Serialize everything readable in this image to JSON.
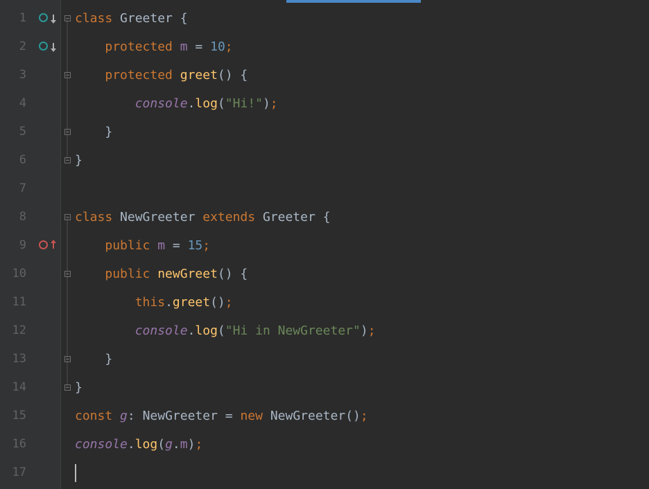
{
  "editor": {
    "lineCount": 17,
    "gutterIcons": {
      "1": "overridden-down",
      "2": "overridden-down",
      "9": "overrides-up"
    },
    "foldMarkers": {
      "1": "open-down",
      "3": "open-down",
      "5": "close-up",
      "6": "close-up",
      "8": "open-down",
      "10": "open-down",
      "13": "close-up",
      "14": "close-up"
    },
    "lines": [
      [
        {
          "t": "class ",
          "c": "keyword"
        },
        {
          "t": "Greeter ",
          "c": "class"
        },
        {
          "t": "{",
          "c": "default"
        }
      ],
      [
        {
          "t": "    ",
          "c": "default"
        },
        {
          "t": "protected ",
          "c": "keyword"
        },
        {
          "t": "m ",
          "c": "prop"
        },
        {
          "t": "= ",
          "c": "default"
        },
        {
          "t": "10",
          "c": "num"
        },
        {
          "t": ";",
          "c": "semi"
        }
      ],
      [
        {
          "t": "    ",
          "c": "default"
        },
        {
          "t": "protected ",
          "c": "keyword"
        },
        {
          "t": "greet",
          "c": "method"
        },
        {
          "t": "() {",
          "c": "default"
        }
      ],
      [
        {
          "t": "        ",
          "c": "default"
        },
        {
          "t": "console",
          "c": "ident-italic"
        },
        {
          "t": ".",
          "c": "default"
        },
        {
          "t": "log",
          "c": "method"
        },
        {
          "t": "(",
          "c": "default"
        },
        {
          "t": "\"Hi!\"",
          "c": "string"
        },
        {
          "t": ")",
          "c": "default"
        },
        {
          "t": ";",
          "c": "semi"
        }
      ],
      [
        {
          "t": "    }",
          "c": "default"
        }
      ],
      [
        {
          "t": "}",
          "c": "default"
        }
      ],
      [
        {
          "t": "",
          "c": "default"
        }
      ],
      [
        {
          "t": "class ",
          "c": "keyword"
        },
        {
          "t": "NewGreeter ",
          "c": "class"
        },
        {
          "t": "extends ",
          "c": "keyword"
        },
        {
          "t": "Greeter ",
          "c": "class"
        },
        {
          "t": "{",
          "c": "default"
        }
      ],
      [
        {
          "t": "    ",
          "c": "default"
        },
        {
          "t": "public ",
          "c": "keyword"
        },
        {
          "t": "m ",
          "c": "prop"
        },
        {
          "t": "= ",
          "c": "default"
        },
        {
          "t": "15",
          "c": "num"
        },
        {
          "t": ";",
          "c": "semi"
        }
      ],
      [
        {
          "t": "    ",
          "c": "default"
        },
        {
          "t": "public ",
          "c": "keyword"
        },
        {
          "t": "newGreet",
          "c": "method"
        },
        {
          "t": "() {",
          "c": "default"
        }
      ],
      [
        {
          "t": "        ",
          "c": "default"
        },
        {
          "t": "this",
          "c": "keyword"
        },
        {
          "t": ".",
          "c": "default"
        },
        {
          "t": "greet",
          "c": "method"
        },
        {
          "t": "()",
          "c": "default"
        },
        {
          "t": ";",
          "c": "semi"
        }
      ],
      [
        {
          "t": "        ",
          "c": "default"
        },
        {
          "t": "console",
          "c": "ident-italic"
        },
        {
          "t": ".",
          "c": "default"
        },
        {
          "t": "log",
          "c": "method"
        },
        {
          "t": "(",
          "c": "default"
        },
        {
          "t": "\"Hi in NewGreeter\"",
          "c": "string"
        },
        {
          "t": ")",
          "c": "default"
        },
        {
          "t": ";",
          "c": "semi"
        }
      ],
      [
        {
          "t": "    }",
          "c": "default"
        }
      ],
      [
        {
          "t": "}",
          "c": "default"
        }
      ],
      [
        {
          "t": "const ",
          "c": "keyword"
        },
        {
          "t": "g",
          "c": "ident-italic"
        },
        {
          "t": ": ",
          "c": "default"
        },
        {
          "t": "NewGreeter ",
          "c": "type"
        },
        {
          "t": "= ",
          "c": "default"
        },
        {
          "t": "new ",
          "c": "keyword"
        },
        {
          "t": "NewGreeter()",
          "c": "default"
        },
        {
          "t": ";",
          "c": "semi"
        }
      ],
      [
        {
          "t": "console",
          "c": "ident-italic"
        },
        {
          "t": ".",
          "c": "default"
        },
        {
          "t": "log",
          "c": "method"
        },
        {
          "t": "(",
          "c": "default"
        },
        {
          "t": "g",
          "c": "ident-italic"
        },
        {
          "t": ".",
          "c": "default"
        },
        {
          "t": "m",
          "c": "prop"
        },
        {
          "t": ")",
          "c": "default"
        },
        {
          "t": ";",
          "c": "semi"
        }
      ],
      [
        {
          "t": "",
          "c": "cursor"
        }
      ]
    ]
  }
}
